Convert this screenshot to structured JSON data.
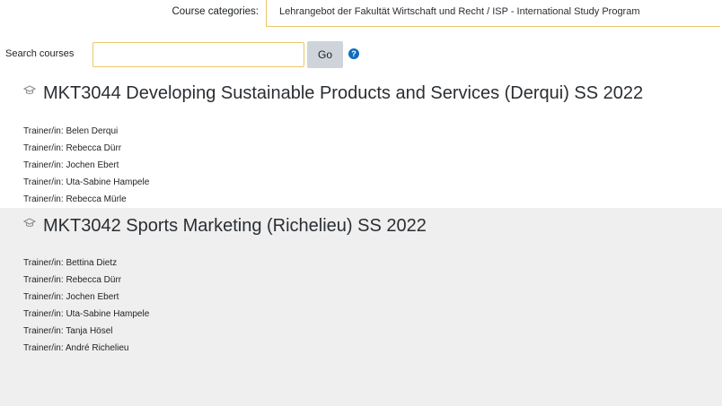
{
  "category": {
    "label": "Course categories:",
    "selected": "Lehrangebot der Fakultät Wirtschaft und Recht / ISP - International Study Program"
  },
  "search": {
    "label": "Search courses",
    "value": "",
    "button_label": "Go",
    "help_icon": "question-circle-icon"
  },
  "colors": {
    "accent_border": "#e8c967",
    "help_icon": "#0f6cbf",
    "button_bg": "#ced4da",
    "alt_course_bg": "#efefef"
  },
  "courses": [
    {
      "title": "MKT3044 Developing Sustainable Products and Services (Derqui) SS 2022",
      "icon": "course-icon",
      "trainers": [
        {
          "role": "Trainer/in",
          "name": "Belen Derqui"
        },
        {
          "role": "Trainer/in",
          "name": "Rebecca Dürr"
        },
        {
          "role": "Trainer/in",
          "name": "Jochen Ebert"
        },
        {
          "role": "Trainer/in",
          "name": "Uta-Sabine Hampele"
        },
        {
          "role": "Trainer/in",
          "name": "Rebecca Mürle"
        }
      ]
    },
    {
      "title": "MKT3042 Sports Marketing (Richelieu) SS 2022",
      "icon": "course-icon",
      "trainers": [
        {
          "role": "Trainer/in",
          "name": "Bettina Dietz"
        },
        {
          "role": "Trainer/in",
          "name": "Rebecca Dürr"
        },
        {
          "role": "Trainer/in",
          "name": "Jochen Ebert"
        },
        {
          "role": "Trainer/in",
          "name": "Uta-Sabine Hampele"
        },
        {
          "role": "Trainer/in",
          "name": "Tanja Hösel"
        },
        {
          "role": "Trainer/in",
          "name": "André Richelieu"
        }
      ]
    }
  ]
}
